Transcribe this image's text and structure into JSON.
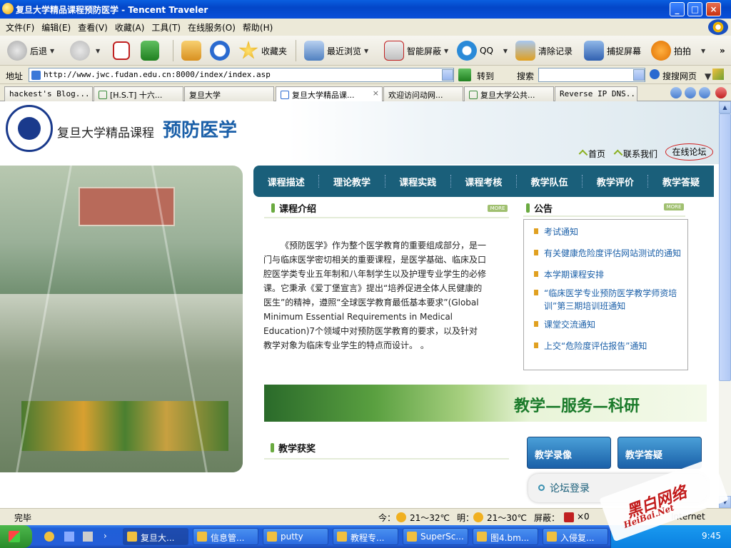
{
  "window": {
    "title": "复旦大学精品课程预防医学 - Tencent Traveler"
  },
  "menu": [
    "文件(F)",
    "编辑(E)",
    "查看(V)",
    "收藏(A)",
    "工具(T)",
    "在线服务(O)",
    "帮助(H)"
  ],
  "toolbar": {
    "back": "后退",
    "favorites": "收藏夹",
    "recent": "最近浏览",
    "smart_block": "智能屏蔽",
    "qq": "QQ",
    "clear_history": "清除记录",
    "capture": "捕捉屏幕",
    "photo": "拍拍",
    "more": "»"
  },
  "address_bar": {
    "label": "地址",
    "url": "http://www.jwc.fudan.edu.cn:8000/index/index.asp",
    "go": "转到",
    "search_label": "搜索",
    "search_value": "",
    "search_web": "搜搜网页"
  },
  "tabs": [
    {
      "label": "hackest's Blog..."
    },
    {
      "label": "[H.S.T] 十六..."
    },
    {
      "label": "复旦大学"
    },
    {
      "label": "复旦大学精品课..."
    },
    {
      "label": "欢迎访问动网..."
    },
    {
      "label": "复旦大学公共..."
    },
    {
      "label": "Reverse IP DNS..."
    }
  ],
  "page": {
    "site_title": "复旦大学精品课程",
    "site_title_big": "预防医学",
    "top_links": {
      "home": "首页",
      "contact": "联系我们",
      "forum": "在线论坛"
    },
    "nav": [
      "课程描述",
      "理论教学",
      "课程实践",
      "课程考核",
      "教学队伍",
      "教学评价",
      "教学答疑"
    ],
    "intro": {
      "title": "课程介绍",
      "more": "MORE",
      "text": "《预防医学》作为整个医学教育的重要组成部分，是一门与临床医学密切相关的重要课程，是医学基础、临床及口腔医学类专业五年制和八年制学生以及护理专业学生的必修课。它秉承《爱丁堡宣言》提出“培养促进全体人民健康的医生”的精神，遵照“全球医学教育最低基本要求”(Global Minimum Essential Requirements in Medical Education)7个领域中对预防医学教育的要求，以及针对教学对象为临床专业学生的特点而设计。 。"
    },
    "notice": {
      "title": "公告",
      "more": "MORE",
      "items": [
        "考试通知",
        "有关健康危险度评估网站测试的通知",
        "本学期课程安排",
        "“临床医学专业预防医学教学师资培训”第三期培训班通知",
        "课堂交流通知",
        "上交“危险度评估报告”通知"
      ]
    },
    "slogan": "教学—服务—科研",
    "awards_title": "教学获奖",
    "buttons": {
      "video": "教学录像",
      "qa": "教学答疑"
    },
    "forum_login": "论坛登录"
  },
  "status_bar": {
    "status": "完毕",
    "today": "今：",
    "today_temp": "21～32℃",
    "tomorrow": "明：",
    "tomorrow_temp": "21～30℃",
    "block": "屏蔽：",
    "block_count": "×0",
    "zone": "Internet"
  },
  "taskbar": {
    "items": [
      "复旦大...",
      "信息管...",
      "putty",
      "教程专...",
      "SuperSc...",
      "图4.bm...",
      "入侵复..."
    ],
    "time": "9:45"
  },
  "watermark": {
    "text": "黑白网络",
    "sub": "HeiBai.Net"
  }
}
